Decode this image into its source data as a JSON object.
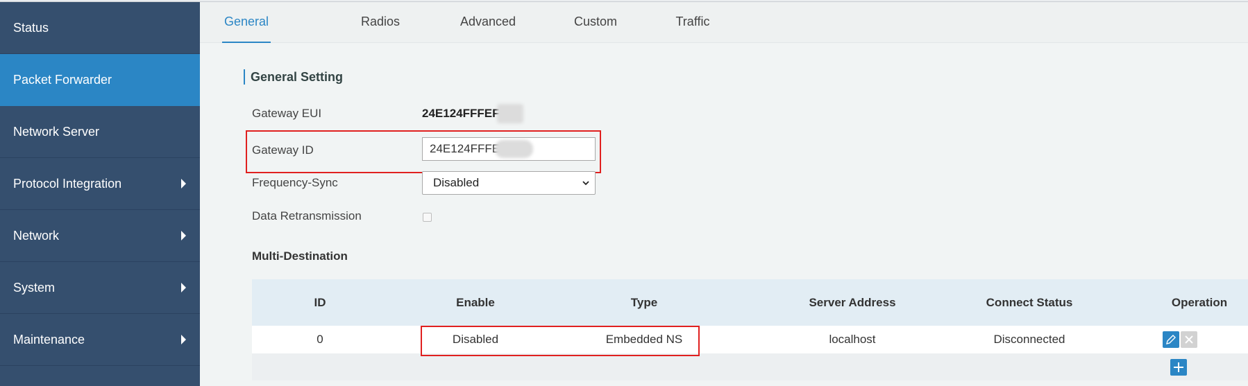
{
  "sidebar": {
    "items": [
      {
        "label": "Status"
      },
      {
        "label": "Packet Forwarder"
      },
      {
        "label": "Network Server"
      },
      {
        "label": "Protocol Integration"
      },
      {
        "label": "Network"
      },
      {
        "label": "System"
      },
      {
        "label": "Maintenance"
      }
    ]
  },
  "tabs": [
    {
      "label": "General"
    },
    {
      "label": "Radios"
    },
    {
      "label": "Advanced"
    },
    {
      "label": "Custom"
    },
    {
      "label": "Traffic"
    }
  ],
  "general_setting": {
    "title": "General Setting",
    "gateway_eui_label": "Gateway EUI",
    "gateway_eui_value": "24E124FFFEF",
    "gateway_id_label": "Gateway ID",
    "gateway_id_value": "24E124FFFE",
    "frequency_sync_label": "Frequency-Sync",
    "frequency_sync_value": "Disabled",
    "data_retransmission_label": "Data Retransmission",
    "data_retransmission_checked": false
  },
  "multi_destination": {
    "title": "Multi-Destination",
    "columns": [
      "ID",
      "Enable",
      "Type",
      "Server Address",
      "Connect Status",
      "Operation"
    ],
    "rows": [
      {
        "id": "0",
        "enable": "Disabled",
        "type": "Embedded NS",
        "server_address": "localhost",
        "connect_status": "Disconnected"
      }
    ]
  },
  "colors": {
    "sidebar_bg": "#354f6e",
    "active_item": "#2b86c5",
    "highlight": "#e0201f"
  }
}
